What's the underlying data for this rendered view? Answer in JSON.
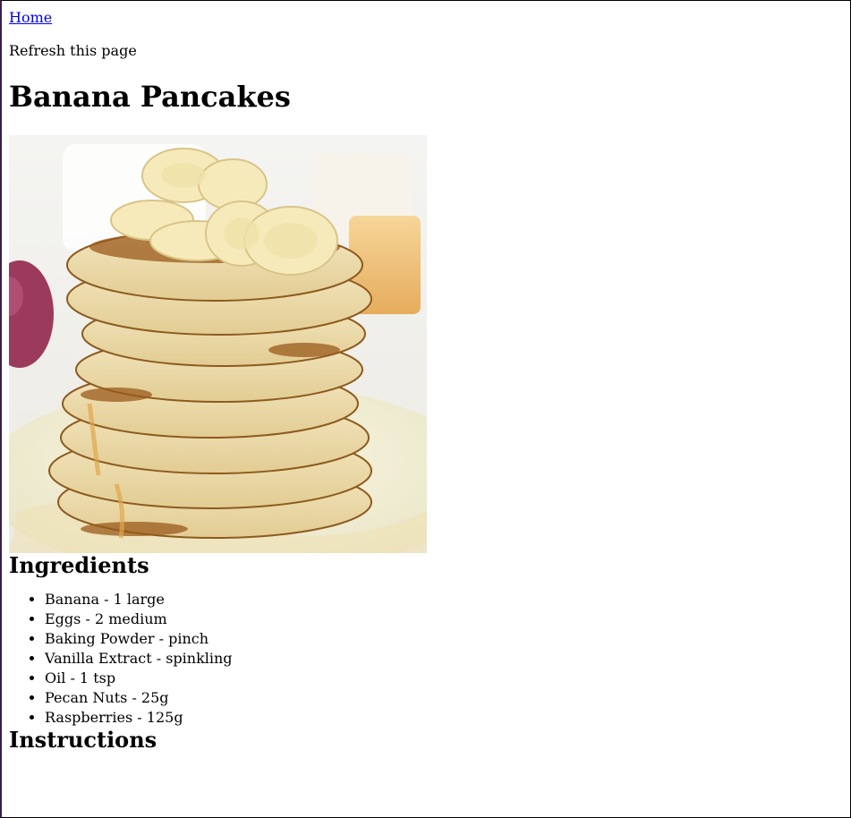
{
  "nav": {
    "home_label": "Home"
  },
  "refresh_text": "Refresh this page",
  "recipe": {
    "title": "Banana Pancakes",
    "ingredients_heading": "Ingredients",
    "ingredients": [
      "Banana - 1 large",
      "Eggs - 2 medium",
      "Baking Powder - pinch",
      "Vanilla Extract - spinkling",
      "Oil - 1 tsp",
      "Pecan Nuts - 25g",
      "Raspberries - 125g"
    ],
    "instructions_heading": "Instructions"
  },
  "colors": {
    "link": "#0000ee",
    "text": "#000000"
  }
}
